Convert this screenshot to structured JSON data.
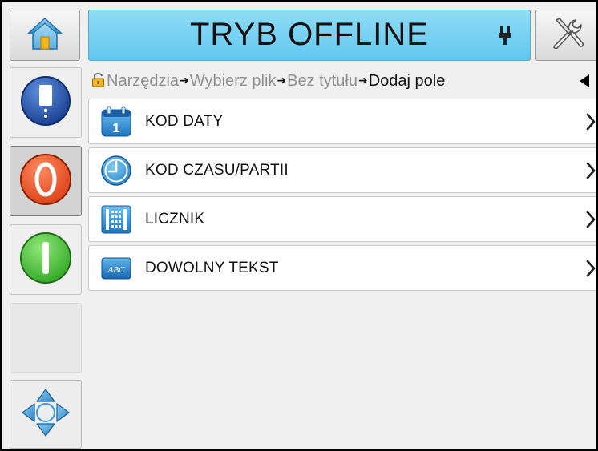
{
  "header": {
    "status_title": "TRYB OFFLINE",
    "status_color": "#6ccbf1",
    "home_icon": "home-icon",
    "tools_icon": "tools-icon",
    "printhead_icon": "printhead-icon"
  },
  "sidebar": {
    "ink_icon": "ink-cartridge-icon",
    "stop_icon": "stop-icon",
    "start_icon": "start-icon",
    "nav_icon": "navigation-arrows-icon",
    "stop_color": "#e8471d",
    "start_color": "#3fc232",
    "ink_color": "#1f4fa8"
  },
  "breadcrumb": {
    "lock_icon": "lock-icon",
    "items": [
      "Narzędzia",
      "Wybierz plik",
      "Bez tytułu",
      "Dodaj pole"
    ],
    "back_icon": "back-triangle-icon"
  },
  "field_list": {
    "items": [
      {
        "label": "KOD DATY",
        "icon": "calendar-icon"
      },
      {
        "label": "KOD CZASU/PARTII",
        "icon": "clock-icon"
      },
      {
        "label": "LICZNIK",
        "icon": "counter-icon"
      },
      {
        "label": "DOWOLNY TEKST",
        "icon": "abc-text-icon"
      }
    ]
  }
}
